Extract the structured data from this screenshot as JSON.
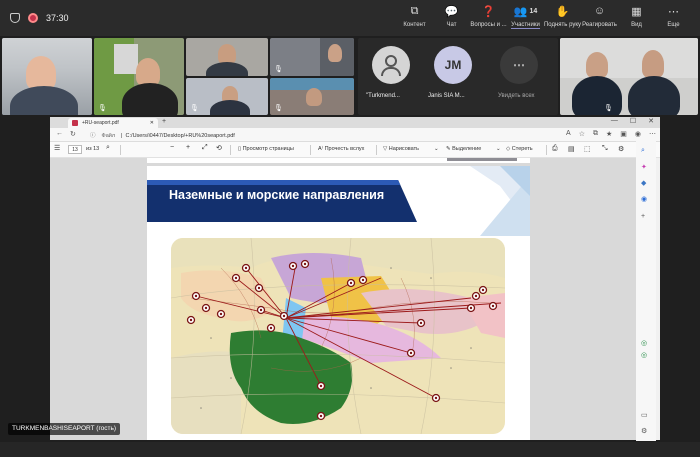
{
  "meeting": {
    "timer": "37:30",
    "toolbar": [
      {
        "id": "content",
        "label": "Контент",
        "icon": "share-screen-icon",
        "glyph": "⧉"
      },
      {
        "id": "chat",
        "label": "Чат",
        "icon": "chat-icon",
        "glyph": "💬"
      },
      {
        "id": "qa",
        "label": "Вопросы и ...",
        "icon": "qa-icon",
        "glyph": "❓"
      },
      {
        "id": "participants",
        "label": "Участники",
        "icon": "people-icon",
        "glyph": "👥",
        "count": "14"
      },
      {
        "id": "raise",
        "label": "Поднять руку",
        "icon": "raise-hand-icon",
        "glyph": "✋"
      },
      {
        "id": "react",
        "label": "Реагировать",
        "icon": "reaction-icon",
        "glyph": "☺"
      },
      {
        "id": "view",
        "label": "Вид",
        "icon": "grid-view-icon",
        "glyph": "▦"
      },
      {
        "id": "more",
        "label": "Еще",
        "icon": "more-icon",
        "glyph": "⋯"
      }
    ],
    "participants": [
      {
        "name": "\"Turkmend...",
        "type": "person-avatar"
      },
      {
        "name": "Janis SIA M...",
        "initials": "JM"
      },
      {
        "name": "Увидеть всех",
        "type": "see-all"
      }
    ],
    "guest_label": "TURKMENBASHISEAPORT (гость)"
  },
  "browser": {
    "tab_title": "+RU-seaport.pdf",
    "url_prefix": "Файл",
    "url": "C:/Users/i0447/Desktop/+RU%20seaport.pdf",
    "page_current": "13",
    "page_total": "из 13",
    "toolbar": {
      "fit": "Просмотр страницы",
      "read_aloud": "Прочесть вслух",
      "draw": "Нарисовать",
      "highlight": "Выделение",
      "erase": "Стереть"
    }
  },
  "slide": {
    "title": "Наземные и морские направления"
  },
  "colors": {
    "banner": "#13306e",
    "iran": "#2e7d32",
    "route": "#9c1b1b",
    "teams_bg": "#1f1f1f"
  }
}
